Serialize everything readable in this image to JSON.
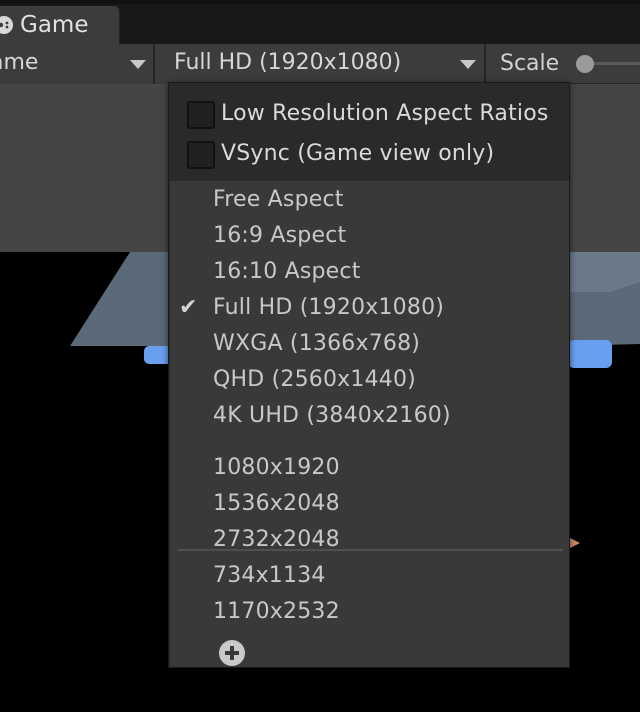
{
  "tab": {
    "label": "Game",
    "icon": "gamepad-icon"
  },
  "toolbar": {
    "display_label": "ame",
    "resolution_label": "Full HD (1920x1080)",
    "scale_label": "Scale"
  },
  "menu": {
    "options": [
      {
        "label": "Low Resolution Aspect Ratios",
        "checked": false
      },
      {
        "label": "VSync (Game view only)",
        "checked": false
      }
    ],
    "builtin_items": [
      {
        "label": "Free Aspect",
        "selected": false
      },
      {
        "label": "16:9 Aspect",
        "selected": false
      },
      {
        "label": "16:10 Aspect",
        "selected": false
      },
      {
        "label": "Full HD (1920x1080)",
        "selected": true
      },
      {
        "label": "WXGA (1366x768)",
        "selected": false
      },
      {
        "label": "QHD (2560x1440)",
        "selected": false
      },
      {
        "label": "4K UHD (3840x2160)",
        "selected": false
      }
    ],
    "custom_items": [
      {
        "label": "1080x1920"
      },
      {
        "label": "1536x2048"
      },
      {
        "label": "2732x2048"
      },
      {
        "label": "734x1134"
      },
      {
        "label": "1170x2532"
      }
    ],
    "check_glyph": "✔",
    "add_icon": "plus-circle-icon"
  },
  "colors": {
    "toolbar_bg": "#3c3c3c",
    "menu_bg": "#393939",
    "scene_accent": "#6a9ff0"
  }
}
